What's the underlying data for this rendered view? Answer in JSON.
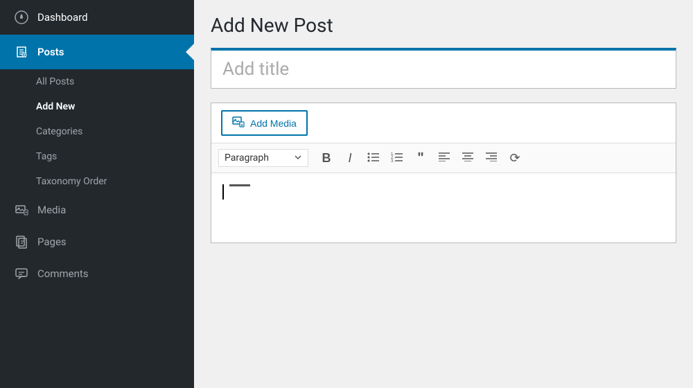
{
  "sidebar": {
    "dashboard": {
      "label": "Dashboard",
      "icon": "🎨"
    },
    "posts_header": {
      "label": "Posts",
      "icon": "📌"
    },
    "posts_sub": [
      {
        "label": "All Posts",
        "active": false
      },
      {
        "label": "Add New",
        "active": true
      },
      {
        "label": "Categories",
        "active": false
      },
      {
        "label": "Tags",
        "active": false
      },
      {
        "label": "Taxonomy Order",
        "active": false
      }
    ],
    "media": {
      "label": "Media",
      "icon": "🖼"
    },
    "pages": {
      "label": "Pages",
      "icon": "📄"
    },
    "comments": {
      "label": "Comments",
      "icon": "💬"
    }
  },
  "main": {
    "page_title": "Add New Post",
    "title_placeholder": "Add title",
    "add_media_label": "Add Media",
    "toolbar": {
      "format_label": "Paragraph",
      "bold": "B",
      "italic": "I"
    }
  }
}
